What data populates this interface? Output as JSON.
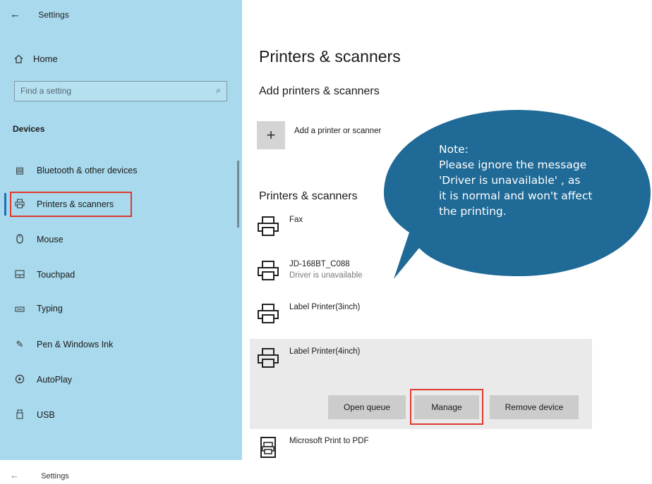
{
  "window": {
    "back_glyph": "←",
    "title": "Settings"
  },
  "sidebar": {
    "home": "Home",
    "search_placeholder": "Find a setting",
    "section": "Devices",
    "items": [
      {
        "label": "Bluetooth & other devices",
        "icon": "bluetooth-devices-icon"
      },
      {
        "label": "Printers & scanners",
        "icon": "printer-icon",
        "selected": true
      },
      {
        "label": "Mouse",
        "icon": "mouse-icon"
      },
      {
        "label": "Touchpad",
        "icon": "touchpad-icon"
      },
      {
        "label": "Typing",
        "icon": "keyboard-icon"
      },
      {
        "label": "Pen & Windows Ink",
        "icon": "pen-icon"
      },
      {
        "label": "AutoPlay",
        "icon": "autoplay-icon"
      },
      {
        "label": "USB",
        "icon": "usb-icon"
      }
    ]
  },
  "main": {
    "title": "Printers & scanners",
    "add_title": "Add printers & scanners",
    "add_label": "Add a printer or scanner",
    "list_title": "Printers & scanners",
    "printers": [
      {
        "name": "Fax",
        "status": ""
      },
      {
        "name": "JD-168BT_C088",
        "status": "Driver is unavailable"
      },
      {
        "name": "Label Printer(3inch)",
        "status": ""
      },
      {
        "name": "Label Printer(4inch)",
        "status": ""
      },
      {
        "name": "Microsoft Print to PDF",
        "status": ""
      }
    ],
    "buttons": {
      "open_queue": "Open queue",
      "manage": "Manage",
      "remove": "Remove device"
    }
  },
  "note": {
    "heading": "Note:",
    "lines": [
      "Please ignore the message",
      "'Driver is unavailable' , as",
      "it is normal and won't affect",
      "the printing."
    ]
  },
  "bottom": {
    "back_glyph": "←",
    "title": "Settings"
  },
  "colors": {
    "sidebar": "#a8d9ec",
    "bubble": "#1f6a96",
    "highlight": "#e0392f",
    "accent": "#1d6fb8"
  }
}
